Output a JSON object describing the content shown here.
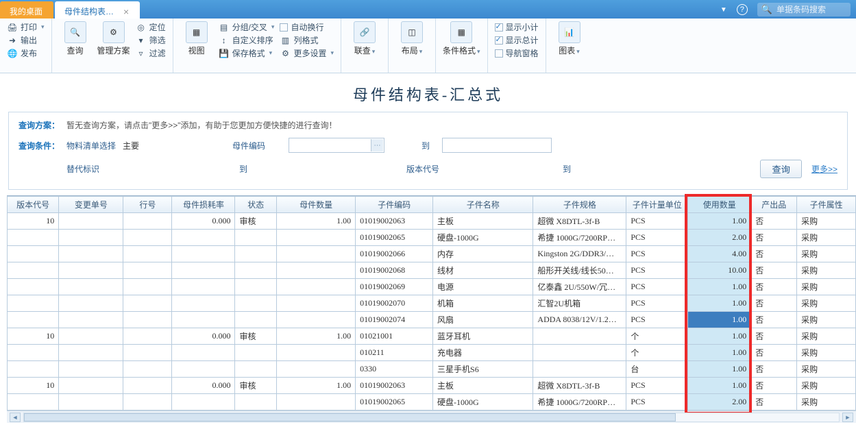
{
  "titlebar": {
    "tab_desktop": "我的桌面",
    "tab_active": "母件结构表…",
    "search_placeholder": "单据条码搜索"
  },
  "ribbon": {
    "g1": {
      "print": "打印",
      "output": "输出",
      "publish": "发布"
    },
    "g2": {
      "query": "查询",
      "mgmt": "管理方案",
      "locate": "定位",
      "filter": "筛选",
      "pass": "过滤"
    },
    "g3": {
      "view": "视图",
      "group": "分组/交叉",
      "custom_sort": "自定义排序",
      "save_fmt": "保存格式",
      "col_fmt": "列格式",
      "more": "更多设置",
      "autowrap": "自动换行"
    },
    "g4": {
      "link": "联查"
    },
    "g5": {
      "layout": "布局"
    },
    "g6": {
      "cond_fmt": "条件格式"
    },
    "g7": {
      "subtotal": "显示小计",
      "grandtotal": "显示总计",
      "navpane": "导航窗格"
    },
    "g8": {
      "chart": "图表"
    }
  },
  "page_title": "母件结构表-汇总式",
  "query": {
    "plan_label": "查询方案：",
    "plan_hint": "暂无查询方案，请点击\"更多>>\"添加，有助于您更加方便快捷的进行查询！",
    "cond_label": "查询条件：",
    "bom_sel": "物料清单选择",
    "bom_sel_val": "主要",
    "parent_code": "母件编码",
    "to": "到",
    "alt_id": "替代标识",
    "version": "版本代号",
    "btn_query": "查询",
    "more": "更多>>"
  },
  "grid": {
    "headers": [
      "版本代号",
      "变更单号",
      "行号",
      "母件损耗率",
      "状态",
      "母件数量",
      "子件编码",
      "子件名称",
      "子件规格",
      "子件计量单位",
      "使用数量",
      "产出品",
      "子件属性"
    ],
    "rows": [
      {
        "ver": "10",
        "chg": "",
        "line": "",
        "loss": "0.000",
        "stat": "审核",
        "pqty": "1.00",
        "ccode": "01019002063",
        "cname": "主板",
        "cspec": "超微 X8DTL-3f-B",
        "cunit": "PCS",
        "uqty": "1.00",
        "out": "否",
        "attr": "采购"
      },
      {
        "ver": "",
        "chg": "",
        "line": "",
        "loss": "",
        "stat": "",
        "pqty": "",
        "ccode": "01019002065",
        "cname": "硬盘-1000G",
        "cspec": "希捷 1000G/7200RP…",
        "cunit": "PCS",
        "uqty": "2.00",
        "out": "否",
        "attr": "采购"
      },
      {
        "ver": "",
        "chg": "",
        "line": "",
        "loss": "",
        "stat": "",
        "pqty": "",
        "ccode": "01019002066",
        "cname": "内存",
        "cspec": "Kingston 2G/DDR3/…",
        "cunit": "PCS",
        "uqty": "4.00",
        "out": "否",
        "attr": "采购"
      },
      {
        "ver": "",
        "chg": "",
        "line": "",
        "loss": "",
        "stat": "",
        "pqty": "",
        "ccode": "01019002068",
        "cname": "线材",
        "cspec": "船形开关线/线长50…",
        "cunit": "PCS",
        "uqty": "10.00",
        "out": "否",
        "attr": "采购"
      },
      {
        "ver": "",
        "chg": "",
        "line": "",
        "loss": "",
        "stat": "",
        "pqty": "",
        "ccode": "01019002069",
        "cname": "电源",
        "cspec": "亿泰鑫 2U/550W/冗…",
        "cunit": "PCS",
        "uqty": "1.00",
        "out": "否",
        "attr": "采购"
      },
      {
        "ver": "",
        "chg": "",
        "line": "",
        "loss": "",
        "stat": "",
        "pqty": "",
        "ccode": "01019002070",
        "cname": "机箱",
        "cspec": "汇智2U机箱",
        "cunit": "PCS",
        "uqty": "1.00",
        "out": "否",
        "attr": "采购"
      },
      {
        "ver": "",
        "chg": "",
        "line": "",
        "loss": "",
        "stat": "",
        "pqty": "",
        "ccode": "01019002074",
        "cname": "风扇",
        "cspec": "ADDA 8038/12V/1.2…",
        "cunit": "PCS",
        "uqty": "1.00",
        "out": "否",
        "attr": "采购",
        "sel": true
      },
      {
        "ver": "10",
        "chg": "",
        "line": "",
        "loss": "0.000",
        "stat": "审核",
        "pqty": "1.00",
        "ccode": "01021001",
        "cname": "蓝牙耳机",
        "cspec": "",
        "cunit": "个",
        "uqty": "1.00",
        "out": "否",
        "attr": "采购"
      },
      {
        "ver": "",
        "chg": "",
        "line": "",
        "loss": "",
        "stat": "",
        "pqty": "",
        "ccode": "010211",
        "cname": "充电器",
        "cspec": "",
        "cunit": "个",
        "uqty": "1.00",
        "out": "否",
        "attr": "采购"
      },
      {
        "ver": "",
        "chg": "",
        "line": "",
        "loss": "",
        "stat": "",
        "pqty": "",
        "ccode": "0330",
        "cname": "三星手机S6",
        "cspec": "",
        "cunit": "台",
        "uqty": "1.00",
        "out": "否",
        "attr": "采购"
      },
      {
        "ver": "10",
        "chg": "",
        "line": "",
        "loss": "0.000",
        "stat": "审核",
        "pqty": "1.00",
        "ccode": "01019002063",
        "cname": "主板",
        "cspec": "超微 X8DTL-3f-B",
        "cunit": "PCS",
        "uqty": "1.00",
        "out": "否",
        "attr": "采购"
      },
      {
        "ver": "",
        "chg": "",
        "line": "",
        "loss": "",
        "stat": "",
        "pqty": "",
        "ccode": "01019002065",
        "cname": "硬盘-1000G",
        "cspec": "希捷 1000G/7200RP…",
        "cunit": "PCS",
        "uqty": "2.00",
        "out": "否",
        "attr": "采购"
      }
    ]
  }
}
